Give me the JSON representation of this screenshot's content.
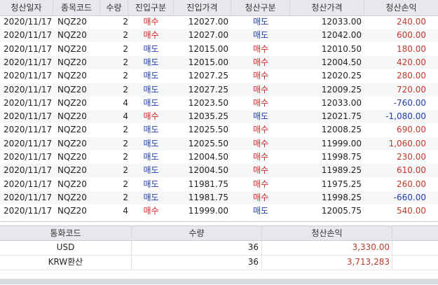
{
  "columns": [
    "청산일자",
    "종목코드",
    "수량",
    "진입구분",
    "진입가격",
    "청산구분",
    "청산가격",
    "청산손익"
  ],
  "rows": [
    {
      "date": "2020/11/17",
      "code": "NQZ20",
      "qty": "2",
      "entry": "매수",
      "entry_price": "12027.00",
      "exit": "매도",
      "exit_price": "12033.00",
      "pnl": "240.00"
    },
    {
      "date": "2020/11/17",
      "code": "NQZ20",
      "qty": "2",
      "entry": "매수",
      "entry_price": "12027.00",
      "exit": "매도",
      "exit_price": "12042.00",
      "pnl": "600.00"
    },
    {
      "date": "2020/11/17",
      "code": "NQZ20",
      "qty": "2",
      "entry": "매도",
      "entry_price": "12015.00",
      "exit": "매수",
      "exit_price": "12010.50",
      "pnl": "180.00"
    },
    {
      "date": "2020/11/17",
      "code": "NQZ20",
      "qty": "2",
      "entry": "매도",
      "entry_price": "12015.00",
      "exit": "매수",
      "exit_price": "12004.50",
      "pnl": "420.00"
    },
    {
      "date": "2020/11/17",
      "code": "NQZ20",
      "qty": "2",
      "entry": "매도",
      "entry_price": "12027.25",
      "exit": "매수",
      "exit_price": "12020.25",
      "pnl": "280.00"
    },
    {
      "date": "2020/11/17",
      "code": "NQZ20",
      "qty": "2",
      "entry": "매도",
      "entry_price": "12027.25",
      "exit": "매수",
      "exit_price": "12009.25",
      "pnl": "720.00"
    },
    {
      "date": "2020/11/17",
      "code": "NQZ20",
      "qty": "4",
      "entry": "매도",
      "entry_price": "12023.50",
      "exit": "매수",
      "exit_price": "12033.00",
      "pnl": "-760.00"
    },
    {
      "date": "2020/11/17",
      "code": "NQZ20",
      "qty": "4",
      "entry": "매수",
      "entry_price": "12035.25",
      "exit": "매도",
      "exit_price": "12021.75",
      "pnl": "-1,080.00"
    },
    {
      "date": "2020/11/17",
      "code": "NQZ20",
      "qty": "2",
      "entry": "매도",
      "entry_price": "12025.50",
      "exit": "매수",
      "exit_price": "12008.25",
      "pnl": "690.00"
    },
    {
      "date": "2020/11/17",
      "code": "NQZ20",
      "qty": "2",
      "entry": "매도",
      "entry_price": "12025.50",
      "exit": "매수",
      "exit_price": "11999.00",
      "pnl": "1,060.00"
    },
    {
      "date": "2020/11/17",
      "code": "NQZ20",
      "qty": "2",
      "entry": "매도",
      "entry_price": "12004.50",
      "exit": "매수",
      "exit_price": "11998.75",
      "pnl": "230.00"
    },
    {
      "date": "2020/11/17",
      "code": "NQZ20",
      "qty": "2",
      "entry": "매도",
      "entry_price": "12004.50",
      "exit": "매수",
      "exit_price": "11989.25",
      "pnl": "610.00"
    },
    {
      "date": "2020/11/17",
      "code": "NQZ20",
      "qty": "2",
      "entry": "매도",
      "entry_price": "11981.75",
      "exit": "매수",
      "exit_price": "11975.25",
      "pnl": "260.00"
    },
    {
      "date": "2020/11/17",
      "code": "NQZ20",
      "qty": "2",
      "entry": "매도",
      "entry_price": "11981.75",
      "exit": "매수",
      "exit_price": "11998.25",
      "pnl": "-660.00"
    },
    {
      "date": "2020/11/17",
      "code": "NQZ20",
      "qty": "4",
      "entry": "매수",
      "entry_price": "11999.00",
      "exit": "매도",
      "exit_price": "12005.75",
      "pnl": "540.00"
    }
  ],
  "summary": {
    "columns": [
      "통화코드",
      "수량",
      "청산손익"
    ],
    "rows": [
      {
        "currency": "USD",
        "qty": "36",
        "pnl": "3,330.00"
      },
      {
        "currency": "KRW환산",
        "qty": "36",
        "pnl": "3,713,283"
      }
    ]
  },
  "colors": {
    "buy": "#d02828",
    "sell": "#1f3fa8",
    "profit": "#c0392b",
    "loss": "#1f3fa8",
    "header_bg": "#e6e8ec"
  }
}
